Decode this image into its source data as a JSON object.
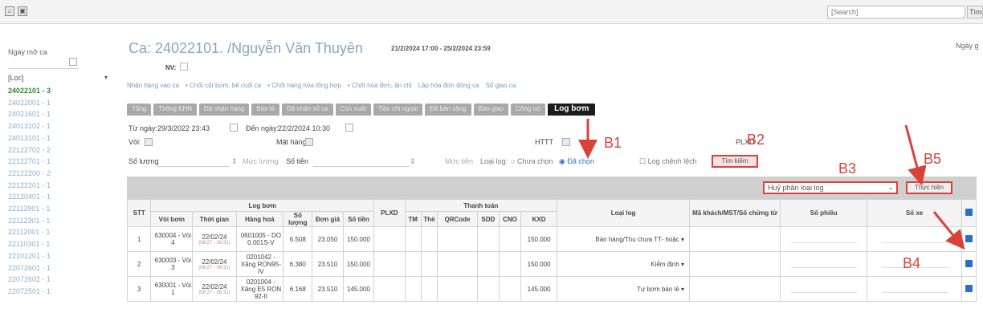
{
  "topbar": {
    "search_placeholder": "[Search]",
    "search_button": "Tìm ki"
  },
  "sidebar": {
    "date_label": "Ngày mở ca",
    "select_value": "[Lọc]",
    "shifts": [
      "24022101 - 3",
      "24022001 - 1",
      "24021601 - 1",
      "24013102 - 1",
      "24013101 - 1",
      "22122702 - 2",
      "22122701 - 1",
      "22122200 - 2",
      "22122201 - 1",
      "22120401 - 1",
      "22112901 - 1",
      "22112301 - 1",
      "22112001 - 1",
      "22110301 - 1",
      "22101201 - 1",
      "22072601 - 1",
      "22072602 - 1",
      "22072501 - 1"
    ]
  },
  "header": {
    "title": "Ca: 24022101. /Nguyễn Văn Thuyên",
    "daterange": "21/2/2024 17:00 - 25/2/2024 23:59",
    "right_label": "Ngày g",
    "nv_label": "NV:"
  },
  "actions": [
    "Nhận hàng vào ca",
    "• Chốt cột bơm, bể cuối ca",
    "• Chốt hàng hóa tổng hợp",
    "• Chốt hóa đơn, ấn chỉ",
    "Lập hóa đơn đóng ca",
    "Sổ giao ca"
  ],
  "tabs": [
    "Tổng",
    "Thông KHN",
    "Đã nhận hàng",
    "Bán lẻ",
    "Đã nhận sổ ca",
    "Còn xuất",
    "Tiền chi ngoài",
    "Đã bán xăng",
    "Bàn giao",
    "Công nợ",
    "Log bơm"
  ],
  "filters": {
    "from_label": "Từ ngày:",
    "from_value": "29/3/2022 23:43",
    "to_label": "Đến ngày:",
    "to_value": "22/2/2024 10:30",
    "voi_label": "Vòi:",
    "mathang_label": "Mặt hàng:",
    "httt_label": "HTTT",
    "plxd_label": "PLXD",
    "soluong_label": "Số lượng",
    "muc_luong": "Mức lượng",
    "sotien_label": "Số tiền",
    "muc_tien": "Mức tiền",
    "loailog_label": "Loại log:",
    "radio_chuachon": "Chưa chọn",
    "radio_dachon": "Đã chọn",
    "check_chenhlech": "Log chênh lệch",
    "find_button": "Tìm kiếm"
  },
  "bulk": {
    "select_value": "Huỷ phân loại log",
    "exec_button": "Thực hiện"
  },
  "table": {
    "group_logbom": "Log bơm",
    "group_thanhtoan": "Thanh toán",
    "headers": {
      "stt": "STT",
      "voi": "Vòi bơm",
      "thoigian": "Thời gian",
      "hanghoa": "Hàng hoá",
      "soluong": "Số lượng",
      "dongia": "Đơn giá",
      "sotien": "Số tiền",
      "plxd": "PLXD",
      "tm": "TM",
      "the": "Thẻ",
      "qr": "QRCode",
      "sdd": "SDD",
      "cno": "CNO",
      "kxd": "KXD",
      "loailog": "Loại log",
      "makh": "Mã khách/MST/Số chứng từ",
      "sophieu": "Số phiếu",
      "soxe": "Số xe"
    },
    "rows": [
      {
        "stt": "1",
        "voi": "630004 - Vòi 4",
        "thoigian": "22/02/24",
        "sub": "(08:27 - 08:31)",
        "hanghoa": "0601005 - DO 0.001S-V",
        "soluong": "6.508",
        "dongia": "23.050",
        "sotien": "150.000",
        "kxd": "150.000",
        "loailog": "Bán hàng/Thu chưa TT- hoặc"
      },
      {
        "stt": "2",
        "voi": "630003 - Vòi 3",
        "thoigian": "22/02/24",
        "sub": "(08:27 - 08:31)",
        "hanghoa": "0201042 - Xăng RON95-IV",
        "soluong": "6.380",
        "dongia": "23.510",
        "sotien": "150.000",
        "kxd": "150.000",
        "loailog": "Kiểm định"
      },
      {
        "stt": "3",
        "voi": "630001 - Vòi 1",
        "thoigian": "22/02/24",
        "sub": "(08:27 - 08:31)",
        "hanghoa": "0201004 - Xăng E5 RON 92-II",
        "soluong": "6.168",
        "dongia": "23.510",
        "sotien": "145.000",
        "kxd": "145.000",
        "loailog": "Tự bơm bán lẻ"
      }
    ]
  },
  "annotations": [
    "B1",
    "B2",
    "B3",
    "B4",
    "B5"
  ],
  "colors": {
    "accent_red": "#d9423a",
    "title_blue": "#8aa6c2",
    "active_green": "#2e8a2e",
    "checkbox_blue": "#2a6fc7"
  }
}
